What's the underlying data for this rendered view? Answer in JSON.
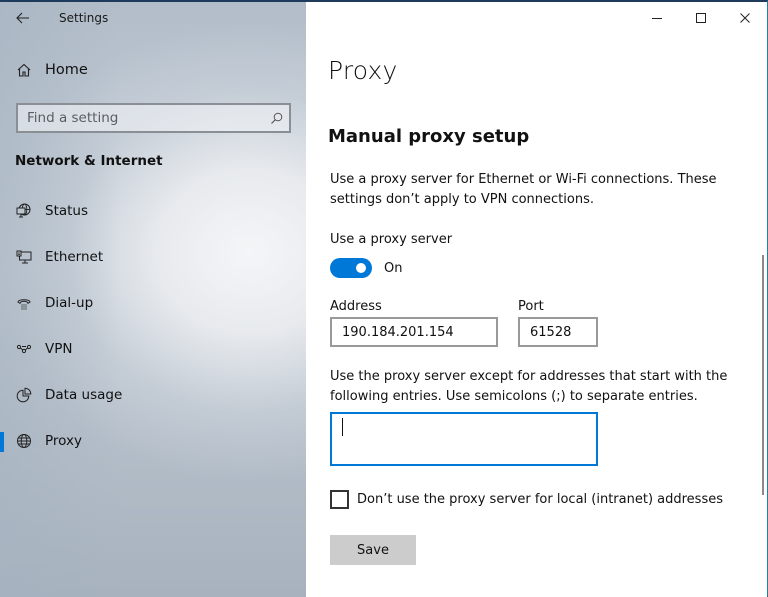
{
  "window": {
    "app_title": "Settings",
    "controls": {
      "minimize": "minimize-icon",
      "maximize": "maximize-icon",
      "close": "close-icon"
    }
  },
  "sidebar": {
    "back_icon": "back-arrow-icon",
    "home": {
      "label": "Home",
      "icon": "home-icon"
    },
    "search": {
      "placeholder": "Find a setting",
      "value": "",
      "icon": "search-icon"
    },
    "section_header": "Network & Internet",
    "items": [
      {
        "label": "Status",
        "icon": "globe-monitor-icon",
        "active": false
      },
      {
        "label": "Ethernet",
        "icon": "ethernet-icon",
        "active": false
      },
      {
        "label": "Dial-up",
        "icon": "dialup-phone-icon",
        "active": false
      },
      {
        "label": "VPN",
        "icon": "vpn-icon",
        "active": false
      },
      {
        "label": "Data usage",
        "icon": "pie-chart-icon",
        "active": false
      },
      {
        "label": "Proxy",
        "icon": "globe-icon",
        "active": true
      }
    ]
  },
  "main": {
    "title": "Proxy",
    "section_title": "Manual proxy setup",
    "description": "Use a proxy server for Ethernet or Wi-Fi connections. These settings don’t apply to VPN connections.",
    "use_proxy": {
      "label": "Use a proxy server",
      "state": "On",
      "enabled": true
    },
    "address": {
      "label": "Address",
      "value": "190.184.201.154"
    },
    "port": {
      "label": "Port",
      "value": "61528"
    },
    "exceptions": {
      "description": "Use the proxy server except for addresses that start with the following entries. Use semicolons (;) to separate entries.",
      "value": ""
    },
    "local_bypass": {
      "label": "Don’t use the proxy server for local (intranet) addresses",
      "checked": false
    },
    "save_label": "Save"
  },
  "colors": {
    "accent": "#0078d7",
    "save_button_bg": "#cccccc"
  }
}
